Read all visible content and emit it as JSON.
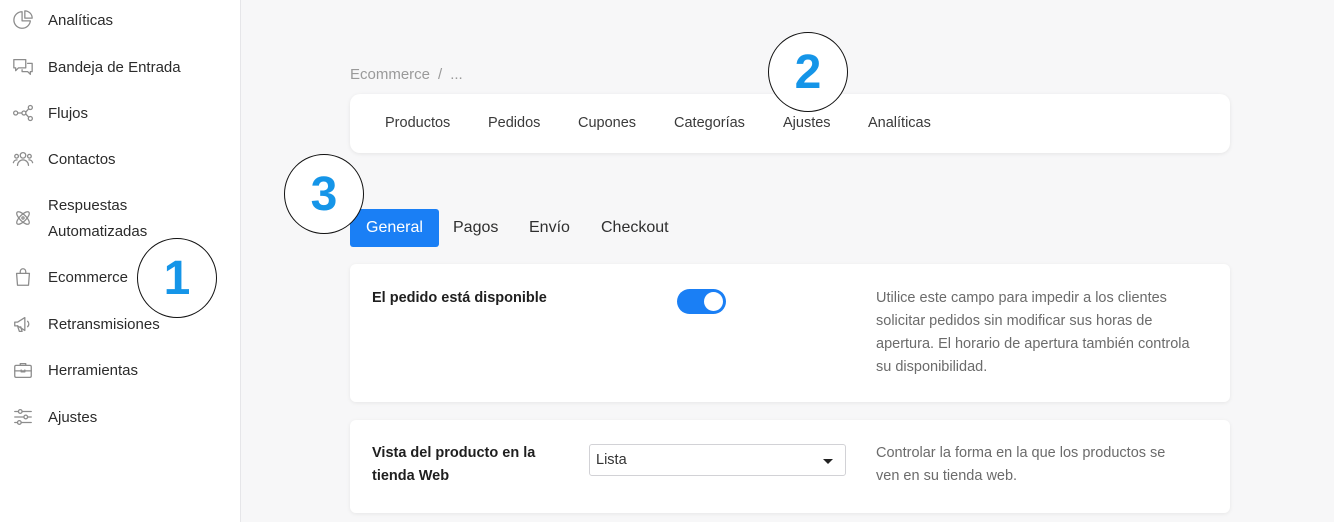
{
  "sidebar": {
    "items": [
      {
        "label": "Analíticas",
        "icon": "pie-chart-icon"
      },
      {
        "label": "Bandeja de Entrada",
        "icon": "chat-bubbles-icon"
      },
      {
        "label": "Flujos",
        "icon": "flow-icon"
      },
      {
        "label": "Contactos",
        "icon": "contacts-icon"
      },
      {
        "label": "Respuestas",
        "label2": "Automatizadas",
        "icon": "atom-icon"
      },
      {
        "label": "Ecommerce",
        "icon": "shopping-bag-icon"
      },
      {
        "label": "Retransmisiones",
        "icon": "megaphone-icon"
      },
      {
        "label": "Herramientas",
        "icon": "toolbox-icon"
      },
      {
        "label": "Ajustes",
        "icon": "sliders-icon"
      }
    ]
  },
  "breadcrumb": {
    "root": "Ecommerce",
    "separator": "/",
    "current": "..."
  },
  "topnav": {
    "items": [
      "Productos",
      "Pedidos",
      "Cupones",
      "Categorías",
      "Ajustes",
      "Analíticas"
    ]
  },
  "tabs": {
    "items": [
      "General",
      "Pagos",
      "Envío",
      "Checkout"
    ],
    "active": "General"
  },
  "settings": {
    "order_available": {
      "title": "El pedido está disponible",
      "enabled": true,
      "desc1": "Utilice este campo para impedir a los clientes",
      "desc2": "solicitar pedidos sin modificar sus horas de",
      "desc3": "apertura. El horario de apertura también controla",
      "desc4": "su disponibilidad."
    },
    "product_view": {
      "title1": "Vista del producto en la",
      "title2": "tienda Web",
      "selected": "Lista",
      "desc1": "Controlar la forma en la que los productos se",
      "desc2": "ven en su tienda web."
    }
  },
  "callouts": {
    "one": "1",
    "two": "2",
    "three": "3"
  },
  "colors": {
    "accent": "#1a7ff5",
    "callout_number": "#1595e8"
  }
}
